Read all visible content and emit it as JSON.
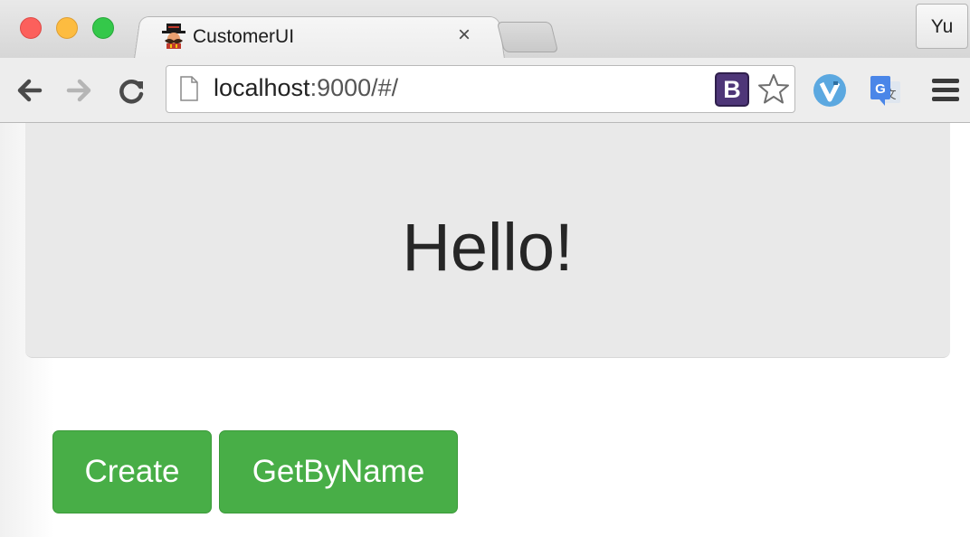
{
  "browser": {
    "tab": {
      "title": "CustomerUI",
      "close_glyph": "×"
    },
    "profile": {
      "label": "Yu"
    },
    "address_bar": {
      "host": "localhost",
      "rest": ":9000/#/"
    },
    "extensions": [
      {
        "name": "bootstrap-extension-icon",
        "label": "B",
        "color": "#4e3678"
      },
      {
        "name": "bookmark-star-icon"
      },
      {
        "name": "vimium-extension-icon",
        "color": "#5ba8e0"
      },
      {
        "name": "google-translate-icon",
        "color": "#4a86e8"
      },
      {
        "name": "chrome-menu-icon"
      }
    ]
  },
  "page": {
    "jumbotron": {
      "heading": "Hello!"
    },
    "buttons": {
      "create": "Create",
      "get_by_name": "GetByName"
    },
    "colors": {
      "button": "#48ae47",
      "jumbotron": "#e9e9e9"
    }
  }
}
